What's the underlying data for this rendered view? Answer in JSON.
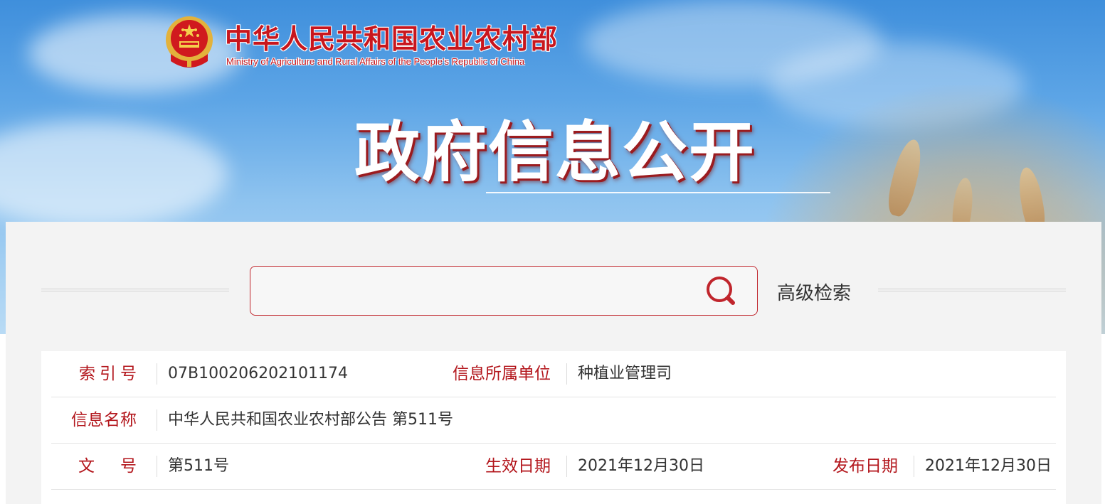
{
  "header": {
    "ministry_cn": "中华人民共和国农业农村部",
    "ministry_en": "Ministry of Agriculture and Rural Affairs of the People's Republic of China",
    "hero_title": "政府信息公开",
    "emblem_icon": "national-emblem-icon"
  },
  "search": {
    "placeholder": "",
    "value": "",
    "search_icon": "search-icon",
    "advanced_label": "高级检索"
  },
  "metadata": {
    "index_label": "索引号",
    "index_value": "07B100206202101174",
    "unit_label": "信息所属单位",
    "unit_value": "种植业管理司",
    "name_label": "信息名称",
    "name_value": "中华人民共和国农业农村部公告 第511号",
    "doc_no_label": "文号",
    "doc_no_value": "第511号",
    "effective_label": "生效日期",
    "effective_value": "2021年12月30日",
    "publish_label": "发布日期",
    "publish_value": "2021年12月30日"
  },
  "colors": {
    "brand_red": "#c8161d",
    "label_red": "#b3161c",
    "sky_blue": "#5da5e6",
    "panel_bg": "#f3f3f3"
  }
}
